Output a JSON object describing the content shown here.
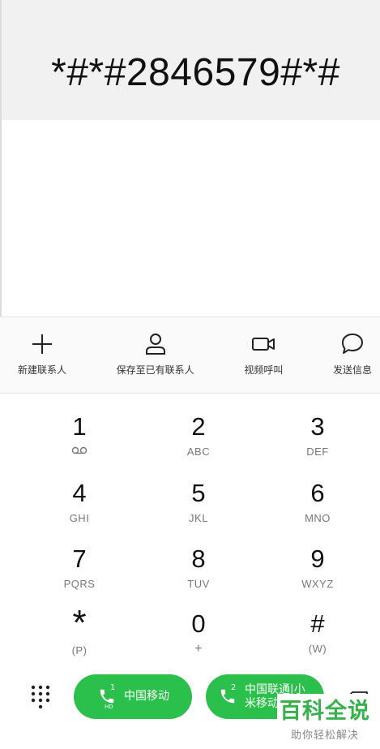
{
  "display": {
    "number": "*#*#2846579#*#"
  },
  "actions": [
    {
      "label": "新建联系人",
      "icon": "plus-icon"
    },
    {
      "label": "保存至已有联系人",
      "icon": "person-icon"
    },
    {
      "label": "视频呼叫",
      "icon": "video-camera-icon"
    },
    {
      "label": "发送信息",
      "icon": "message-bubble-icon"
    }
  ],
  "keypad": [
    {
      "digit": "1",
      "letters": "voicemail-icon"
    },
    {
      "digit": "2",
      "letters": "ABC"
    },
    {
      "digit": "3",
      "letters": "DEF"
    },
    {
      "digit": "4",
      "letters": "GHI"
    },
    {
      "digit": "5",
      "letters": "JKL"
    },
    {
      "digit": "6",
      "letters": "MNO"
    },
    {
      "digit": "7",
      "letters": "PQRS"
    },
    {
      "digit": "8",
      "letters": "TUV"
    },
    {
      "digit": "9",
      "letters": "WXYZ"
    },
    {
      "digit": "*",
      "letters": "(P)"
    },
    {
      "digit": "0",
      "letters": "+"
    },
    {
      "digit": "#",
      "letters": "(W)"
    }
  ],
  "call_buttons": [
    {
      "sim": "1",
      "badge": "HD",
      "label": "中国移动"
    },
    {
      "sim": "2",
      "label_line1": "中国联通|小",
      "label_line2": "米移动"
    }
  ],
  "watermark": {
    "title": "百科全说",
    "subtitle": "助你轻松解决"
  },
  "colors": {
    "accent": "#2bbf4b",
    "display_bg": "#f1f1f1",
    "watermark": "#36b24a"
  }
}
